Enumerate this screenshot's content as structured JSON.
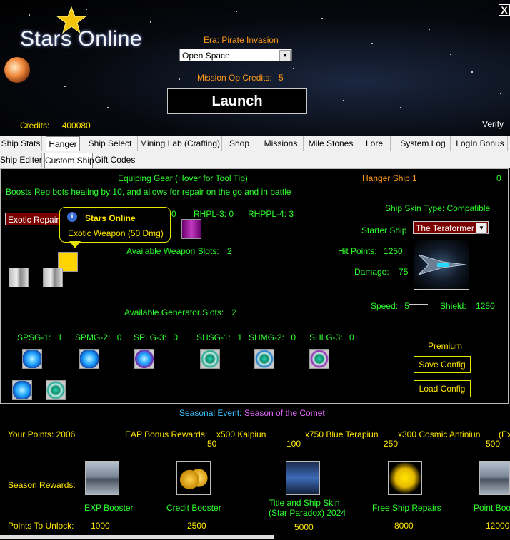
{
  "app": {
    "title": "Stars Online",
    "close": "X"
  },
  "header": {
    "era": "Era: Pirate Invasion",
    "location_selected": "Open Space",
    "mission_op_credits_label": "Mission Op Credits:",
    "mission_op_credits_value": "5",
    "launch": "Launch",
    "credits_label": "Credits:",
    "credits_value": "400080",
    "verify": "Verify"
  },
  "tabs_row1": [
    "Ship Stats",
    "Hanger",
    "Ship Select",
    "Mining Lab (Crafting)",
    "Shop",
    "Missions",
    "Mile Stones",
    "Lore",
    "System Log",
    "LogIn Bonus"
  ],
  "tabs_row2": [
    "Ship Editer",
    "Custom Ship",
    "Gift Codes"
  ],
  "active_tab": "Hanger",
  "hanger": {
    "equipping_title": "Equiping Gear (Hover for Tool Tip)",
    "hanger_ship": "Hanger Ship 1",
    "hanger_ship_count": "0",
    "gear_description": "Boosts Rep bots healing by 10, and allows for repair on the go and in battle",
    "gear_select": "Exotic Repair Q",
    "zero_after_select": "0",
    "rhpl3": "RHPL-3:",
    "rhpl3_value": "0",
    "rhppl4": "RHPPL-4:",
    "rhppl4_value": "3",
    "skin_type": "Ship Skin Type: Compatible",
    "starter_ship_label": "Starter Ship",
    "ship_selected": "The Teraformer",
    "hit_points_label": "Hit Points:",
    "hit_points_value": "1250",
    "damage_label": "Damage:",
    "damage_value": "75",
    "weapon_slots_label": "Available Weapon Slots:",
    "weapon_slots_value": "2",
    "generator_slots_label": "Available Generator Slots:",
    "generator_slots_value": "2",
    "speed_label": "Speed:",
    "speed_value": "5",
    "shield_label": "Shield:",
    "shield_value": "1250",
    "tooltip_title": "Stars Online",
    "tooltip_text": "Exotic Weapon (50 Dmg)",
    "generators": [
      {
        "label": "SPSG-1:",
        "value": "1"
      },
      {
        "label": "SPMG-2:",
        "value": "0"
      },
      {
        "label": "SPLG-3:",
        "value": "0"
      },
      {
        "label": "SHSG-1:",
        "value": "1"
      },
      {
        "label": "SHMG-2:",
        "value": "0"
      },
      {
        "label": "SHLG-3:",
        "value": "0"
      }
    ],
    "premium": "Premium",
    "save_config": "Save Config",
    "load_config": "Load Config"
  },
  "season": {
    "event_label": "Seasonal Event:",
    "event_name": "Season of the Comet",
    "your_points_label": "Your Points:",
    "your_points_value": "2006",
    "eap_label": "EAP Bonus Rewards:",
    "eap_rewards": [
      "x500 Kalpiun",
      "x750 Blue Terapiun",
      "x300 Cosmic Antiniun",
      "(Ex"
    ],
    "eap_points": [
      "50",
      "100",
      "250",
      "500"
    ],
    "season_rewards_label": "Season Rewards:",
    "rewards": [
      "EXP Booster",
      "Credit Booster",
      "Title and Ship Skin",
      "(Star Paradox) 2024",
      "Free Ship Repairs",
      "Point Boos"
    ],
    "points_to_unlock_label": "Points To Unlock:",
    "unlock_points": [
      "1000",
      "2500",
      "5000",
      "8000",
      "12000"
    ]
  },
  "colors": {
    "gear_title": "#2dff2d",
    "season_event": "#3fc2ff",
    "season_name": "#e66bff",
    "tip_border": "#e5e500"
  }
}
